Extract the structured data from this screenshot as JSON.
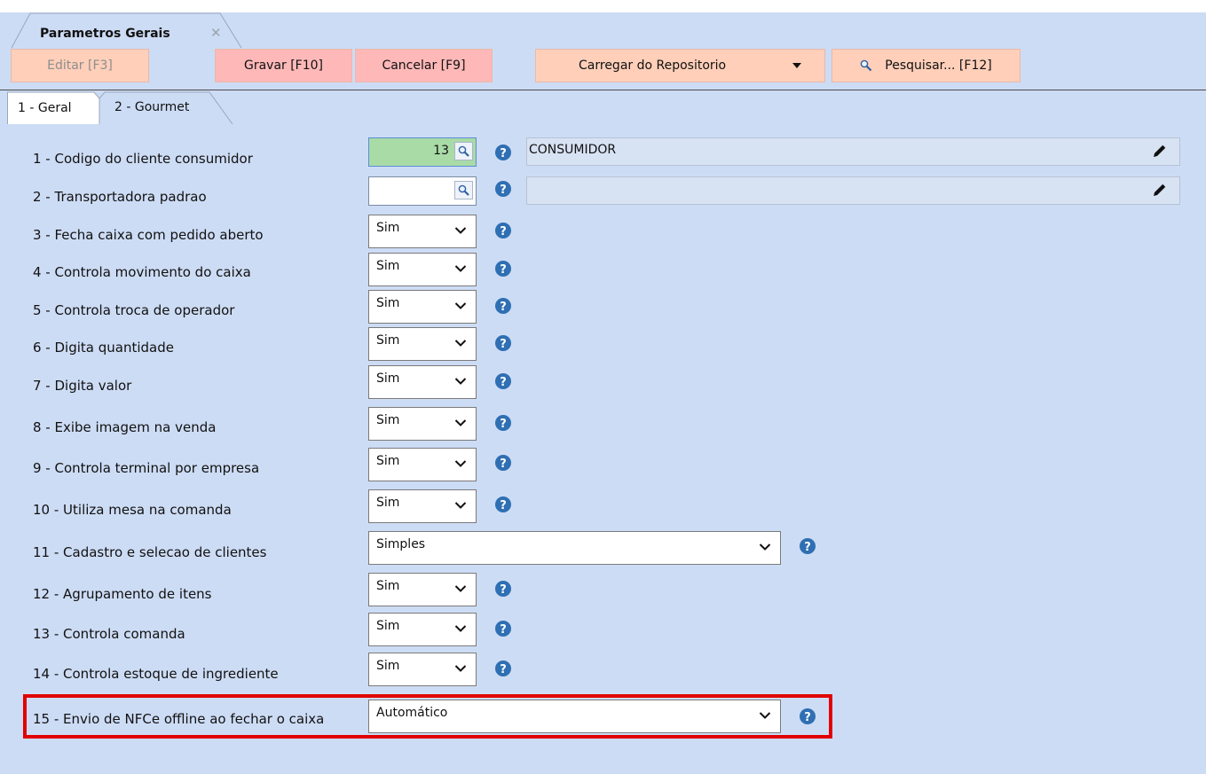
{
  "document_tab": {
    "title": "Parametros Gerais"
  },
  "toolbar": {
    "edit_label": "Editar [F3]",
    "save_label": "Gravar [F10]",
    "cancel_label": "Cancelar [F9]",
    "load_label": "Carregar do Repositorio",
    "search_label": "Pesquisar... [F12]"
  },
  "tabs": [
    {
      "label": "1 - Geral",
      "active": true
    },
    {
      "label": "2 - Gourmet",
      "active": false
    }
  ],
  "fields": [
    {
      "label": "1 - Codigo do cliente consumidor",
      "type": "lookup",
      "value": "13",
      "description": "CONSUMIDOR"
    },
    {
      "label": "2 - Transportadora padrao",
      "type": "lookup",
      "value": "",
      "description": ""
    },
    {
      "label": "3 - Fecha caixa com pedido aberto",
      "type": "select",
      "value": "Sim"
    },
    {
      "label": "4 - Controla movimento do caixa",
      "type": "select",
      "value": "Sim"
    },
    {
      "label": "5 - Controla troca de operador",
      "type": "select",
      "value": "Sim"
    },
    {
      "label": "6 - Digita quantidade",
      "type": "select",
      "value": "Sim"
    },
    {
      "label": "7 - Digita valor",
      "type": "select",
      "value": "Sim"
    },
    {
      "label": "8 - Exibe imagem na venda",
      "type": "select",
      "value": "Sim"
    },
    {
      "label": "9 - Controla terminal por empresa",
      "type": "select",
      "value": "Sim"
    },
    {
      "label": "10 - Utiliza mesa na comanda",
      "type": "select",
      "value": "Sim"
    },
    {
      "label": "11 - Cadastro e selecao de clientes",
      "type": "select",
      "value": "Simples"
    },
    {
      "label": "12 - Agrupamento de itens",
      "type": "select",
      "value": "Sim"
    },
    {
      "label": "13 - Controla comanda",
      "type": "select",
      "value": "Sim"
    },
    {
      "label": "14 - Controla estoque de ingrediente",
      "type": "select",
      "value": "Sim"
    },
    {
      "label": "15 - Envio de NFCe offline ao fechar o caixa",
      "type": "select",
      "value": "Automático"
    }
  ],
  "colors": {
    "background": "#cddcf5",
    "button_peach": "#ffcfb9",
    "button_pink": "#ffb8b8",
    "lookup_filled": "#a9dba6",
    "help_icon": "#2f6fb3",
    "highlight": "#e10000"
  }
}
